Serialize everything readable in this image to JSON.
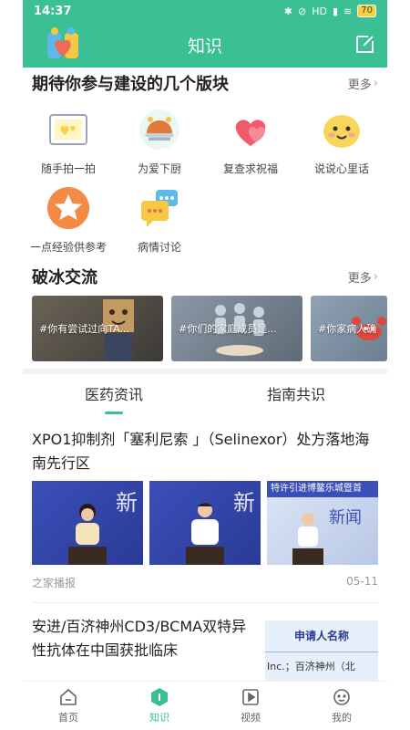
{
  "status_bar": {
    "time": "14:37",
    "network": "HD",
    "battery": "70"
  },
  "header": {
    "title": "知识"
  },
  "sections": {
    "build": {
      "title": "期待你参与建设的几个版块",
      "more": "更多",
      "tiles": [
        {
          "label": "随手拍一拍",
          "icon": "photo-frame-icon"
        },
        {
          "label": "为爱下厨",
          "icon": "roast-chicken-icon"
        },
        {
          "label": "复查求祝福",
          "icon": "hearts-icon"
        },
        {
          "label": "说说心里话",
          "icon": "emoji-face-icon"
        },
        {
          "label": "一点经验供参考",
          "icon": "star-badge-icon"
        },
        {
          "label": "病情讨论",
          "icon": "chat-bubbles-icon"
        }
      ]
    },
    "icebreak": {
      "title": "破冰交流",
      "more": "更多",
      "topics": [
        {
          "label": "#你有尝试过向TA..."
        },
        {
          "label": "#你们的家庭成员是..."
        },
        {
          "label": "#你家病人确"
        }
      ]
    }
  },
  "tabs": [
    "医药资讯",
    "指南共识"
  ],
  "articles": [
    {
      "title": "XPO1抑制剂「塞利尼索 」（Selinexor）处方落地海南先行区",
      "source": "之家播报",
      "date": "05-11",
      "thumb_overlay": [
        "新",
        "新",
        "特许引进博鳌乐城暨首",
        "新闻"
      ]
    },
    {
      "title": "安进/百济神州CD3/BCMA双特异性抗体在中国获批临床",
      "thumb_text": [
        "申请人名称",
        "Inc.；百济神州（北"
      ]
    }
  ],
  "bottom_nav": [
    {
      "label": "首页"
    },
    {
      "label": "知识"
    },
    {
      "label": "视频"
    },
    {
      "label": "我的"
    }
  ],
  "colors": {
    "brand": "#3bbf95"
  }
}
